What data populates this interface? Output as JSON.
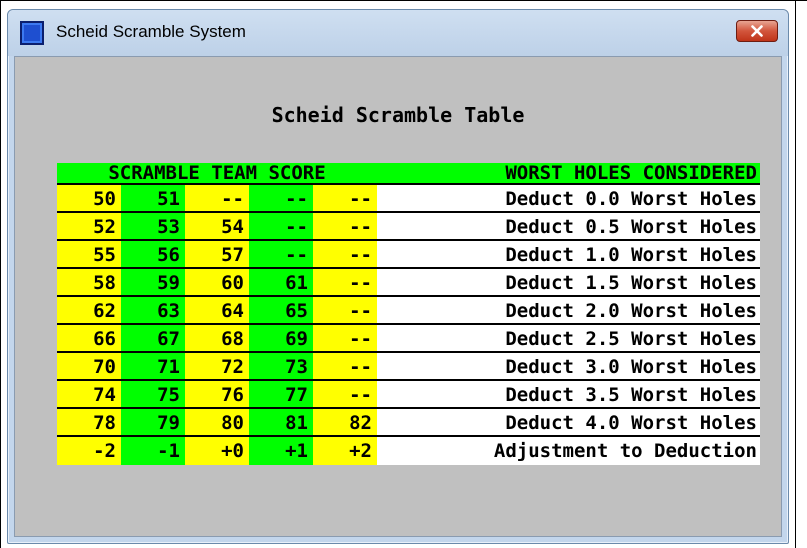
{
  "window": {
    "title": "Scheid Scramble System",
    "close_icon": "close-x-icon",
    "app_icon": "app-window-icon"
  },
  "table": {
    "title": "Scheid Scramble Table",
    "header_left": "SCRAMBLE TEAM SCORE",
    "header_right": "WORST HOLES CONSIDERED",
    "rows": [
      {
        "scores": [
          "50",
          "51",
          "--",
          "--",
          "--"
        ],
        "description": "Deduct 0.0 Worst Holes"
      },
      {
        "scores": [
          "52",
          "53",
          "54",
          "--",
          "--"
        ],
        "description": "Deduct 0.5 Worst Holes"
      },
      {
        "scores": [
          "55",
          "56",
          "57",
          "--",
          "--"
        ],
        "description": "Deduct 1.0 Worst Holes"
      },
      {
        "scores": [
          "58",
          "59",
          "60",
          "61",
          "--"
        ],
        "description": "Deduct 1.5 Worst Holes"
      },
      {
        "scores": [
          "62",
          "63",
          "64",
          "65",
          "--"
        ],
        "description": "Deduct 2.0 Worst Holes"
      },
      {
        "scores": [
          "66",
          "67",
          "68",
          "69",
          "--"
        ],
        "description": "Deduct 2.5 Worst Holes"
      },
      {
        "scores": [
          "70",
          "71",
          "72",
          "73",
          "--"
        ],
        "description": "Deduct 3.0 Worst Holes"
      },
      {
        "scores": [
          "74",
          "75",
          "76",
          "77",
          "--"
        ],
        "description": "Deduct 3.5 Worst Holes"
      },
      {
        "scores": [
          "78",
          "79",
          "80",
          "81",
          "82"
        ],
        "description": "Deduct 4.0 Worst Holes"
      }
    ],
    "adjustment": {
      "values": [
        "-2",
        "-1",
        "+0",
        "+1",
        "+2"
      ],
      "description": "Adjustment to Deduction"
    }
  },
  "colors": {
    "yellow_column": "#ffff00",
    "green_column": "#00ff00",
    "description_column": "#ffffff",
    "client_background": "#c0c0c0"
  }
}
